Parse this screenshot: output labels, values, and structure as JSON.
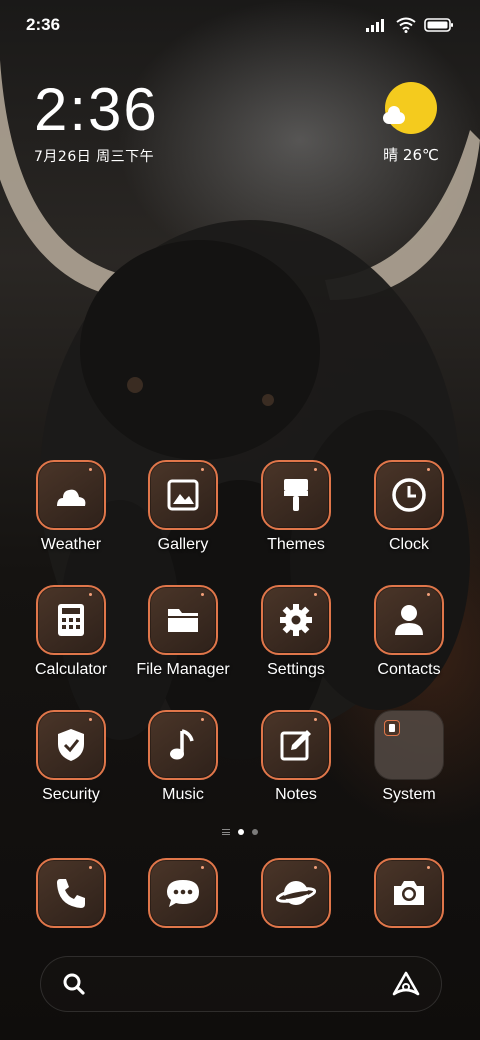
{
  "status_bar": {
    "time": "2:36"
  },
  "clock_widget": {
    "time": "2:36",
    "date": "7月26日 周三下午"
  },
  "weather_widget": {
    "text": "晴 26℃",
    "icon": "partly-sunny-icon"
  },
  "apps": [
    {
      "label": "Weather",
      "icon": "weather-icon"
    },
    {
      "label": "Gallery",
      "icon": "gallery-icon"
    },
    {
      "label": "Themes",
      "icon": "paintbrush-icon"
    },
    {
      "label": "Clock",
      "icon": "clock-icon"
    },
    {
      "label": "Calculator",
      "icon": "calculator-icon"
    },
    {
      "label": "File Manager",
      "icon": "folder-icon"
    },
    {
      "label": "Settings",
      "icon": "gear-icon"
    },
    {
      "label": "Contacts",
      "icon": "person-icon"
    },
    {
      "label": "Security",
      "icon": "shield-check-icon"
    },
    {
      "label": "Music",
      "icon": "music-note-icon"
    },
    {
      "label": "Notes",
      "icon": "note-edit-icon"
    },
    {
      "label": "System",
      "icon": "folder-group-icon"
    }
  ],
  "dock": [
    {
      "icon": "phone-icon"
    },
    {
      "icon": "messages-icon"
    },
    {
      "icon": "browser-planet-icon"
    },
    {
      "icon": "camera-icon"
    }
  ],
  "page_indicator": {
    "pages": 2,
    "active": 1
  },
  "search": {
    "left_icon": "search-icon",
    "right_icon": "assistant-icon"
  },
  "colors": {
    "accent_border": "#e0764a",
    "sun": "#f4cb1e"
  }
}
